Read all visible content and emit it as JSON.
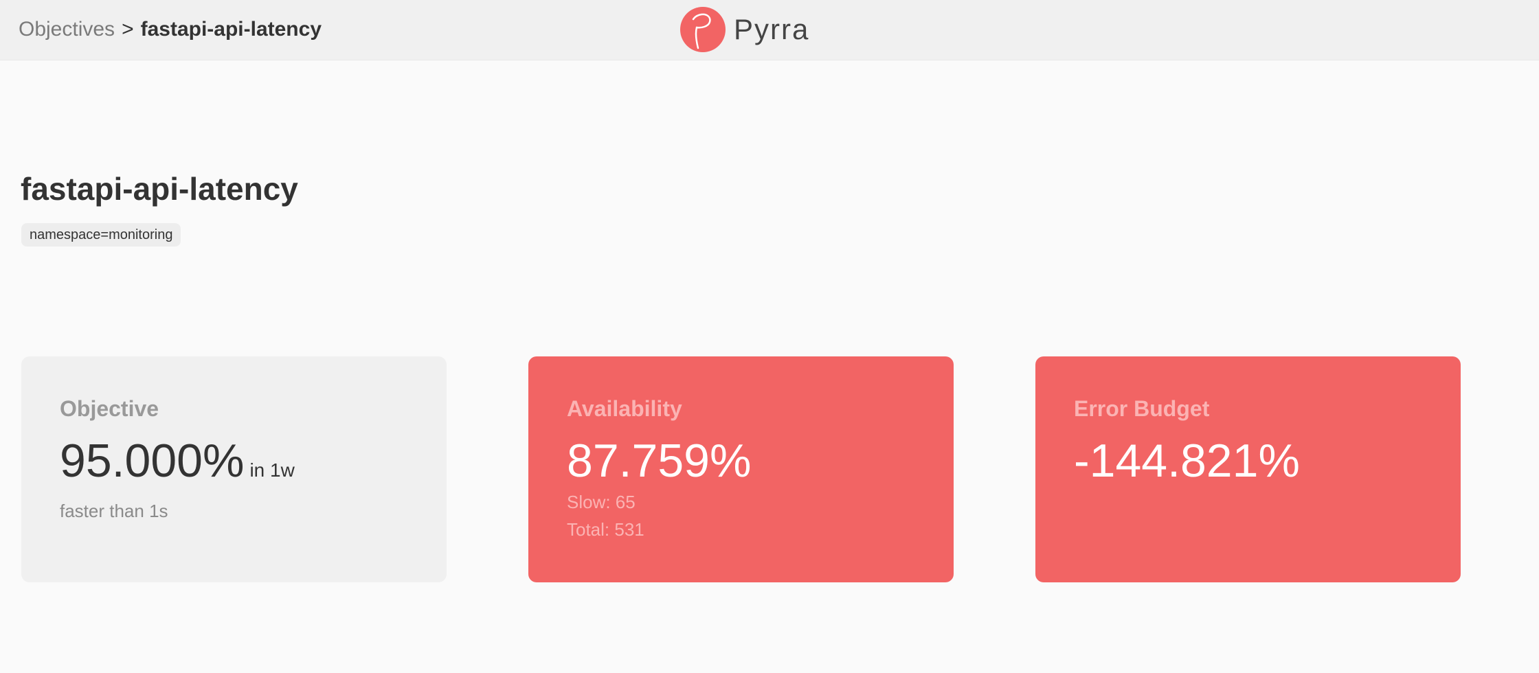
{
  "breadcrumb": {
    "parent_label": "Objectives",
    "separator": ">",
    "current_label": "fastapi-api-latency"
  },
  "brand": {
    "name": "Pyrra",
    "logo_icon": "pyrra-logo-icon",
    "accent_color": "#f26464"
  },
  "objective": {
    "title": "fastapi-api-latency",
    "labels": [
      "namespace=monitoring"
    ]
  },
  "tiles": {
    "objective": {
      "heading": "Objective",
      "value": "95.000%",
      "window": "in 1w",
      "description": "faster than 1s"
    },
    "availability": {
      "heading": "Availability",
      "value": "87.759%",
      "slow": "Slow: 65",
      "total": "Total: 531"
    },
    "error_budget": {
      "heading": "Error Budget",
      "value": "-144.821%"
    }
  },
  "colors": {
    "alert_tile": "#f26464",
    "neutral_tile": "#f0f0f0",
    "header_bg": "#f0f0f0",
    "page_bg": "#fafafa"
  }
}
